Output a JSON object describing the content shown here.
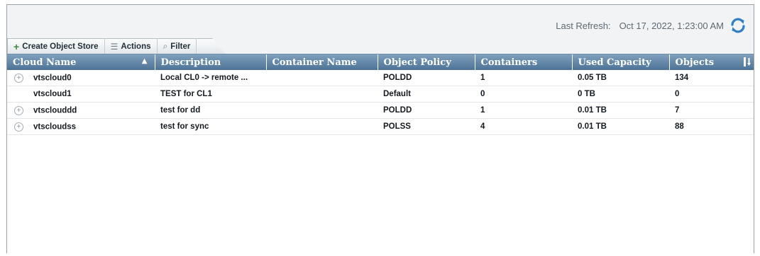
{
  "header": {
    "refresh_label": "Last Refresh:",
    "refresh_time": "Oct 17, 2022, 1:23:00 AM"
  },
  "toolbar": {
    "create_label": "Create Object Store",
    "actions_label": "Actions",
    "filter_label": "Filter"
  },
  "table": {
    "columns": [
      "Cloud Name",
      "Description",
      "Container Name",
      "Object Policy",
      "Containers",
      "Used Capacity",
      "Objects"
    ],
    "sort_column": "Cloud Name",
    "sort_direction": "ascending",
    "rows": [
      {
        "expandable": true,
        "cloud_name": "vtscloud0",
        "description": "Local CL0 -> remote ...",
        "container_name": "",
        "object_policy": "POLDD",
        "containers": "1",
        "used_capacity": "0.05 TB",
        "objects": "134"
      },
      {
        "expandable": false,
        "cloud_name": "vtscloud1",
        "description": "TEST for CL1",
        "container_name": "",
        "object_policy": "Default",
        "containers": "0",
        "used_capacity": "0 TB",
        "objects": "0"
      },
      {
        "expandable": true,
        "cloud_name": "vtsclouddd",
        "description": "test for dd",
        "container_name": "",
        "object_policy": "POLDD",
        "containers": "1",
        "used_capacity": "0.01 TB",
        "objects": "7"
      },
      {
        "expandable": true,
        "cloud_name": "vtscloudss",
        "description": "test for sync",
        "container_name": "",
        "object_policy": "POLSS",
        "containers": "4",
        "used_capacity": "0.01 TB",
        "objects": "88"
      }
    ]
  },
  "icons": {
    "refresh": "refresh-icon",
    "create": "plus-icon",
    "actions": "list-icon",
    "filter": "filter-icon",
    "sort": "sort-ascending-icon",
    "column_menu": "column-menu-icon",
    "expand": "expand-icon"
  },
  "colors": {
    "header_bg": "#5b7fa0",
    "panel_bg": "#f2f3f4",
    "refresh_icon": "#2f7fc8"
  }
}
